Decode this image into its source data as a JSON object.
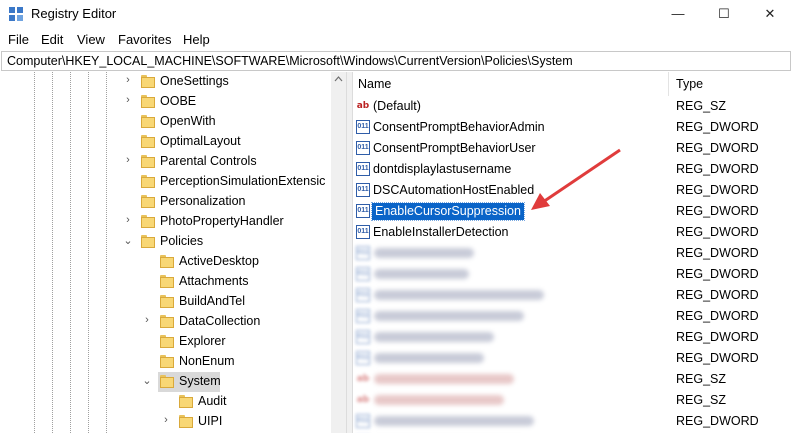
{
  "window": {
    "title": "Registry Editor",
    "controls": {
      "minimize": "—",
      "maximize": "☐",
      "close": "✕"
    }
  },
  "menu": [
    "File",
    "Edit",
    "View",
    "Favorites",
    "Help"
  ],
  "address_path": "Computer\\HKEY_LOCAL_MACHINE\\SOFTWARE\\Microsoft\\Windows\\CurrentVersion\\Policies\\System",
  "tree": [
    {
      "label": "OneSettings",
      "expander": "›"
    },
    {
      "label": "OOBE",
      "expander": "›"
    },
    {
      "label": "OpenWith",
      "expander": ""
    },
    {
      "label": "OptimalLayout",
      "expander": ""
    },
    {
      "label": "Parental Controls",
      "expander": "›"
    },
    {
      "label": "PerceptionSimulationExtensic",
      "expander": ""
    },
    {
      "label": "Personalization",
      "expander": ""
    },
    {
      "label": "PhotoPropertyHandler",
      "expander": "›"
    },
    {
      "label": "Policies",
      "expander": "⌄"
    },
    {
      "label": "ActiveDesktop",
      "expander": ""
    },
    {
      "label": "Attachments",
      "expander": ""
    },
    {
      "label": "BuildAndTel",
      "expander": ""
    },
    {
      "label": "DataCollection",
      "expander": "›"
    },
    {
      "label": "Explorer",
      "expander": ""
    },
    {
      "label": "NonEnum",
      "expander": ""
    },
    {
      "label": "System",
      "expander": "⌄",
      "selected": true
    },
    {
      "label": "Audit",
      "expander": ""
    },
    {
      "label": "UIPI",
      "expander": "›"
    }
  ],
  "list": {
    "columns": {
      "name": "Name",
      "type": "Type"
    },
    "rows": [
      {
        "name": "(Default)",
        "type": "REG_SZ",
        "icon": "string-value-icon"
      },
      {
        "name": "ConsentPromptBehaviorAdmin",
        "type": "REG_DWORD",
        "icon": "dword-value-icon"
      },
      {
        "name": "ConsentPromptBehaviorUser",
        "type": "REG_DWORD",
        "icon": "dword-value-icon"
      },
      {
        "name": "dontdisplaylastusername",
        "type": "REG_DWORD",
        "icon": "dword-value-icon"
      },
      {
        "name": "DSCAutomationHostEnabled",
        "type": "REG_DWORD",
        "icon": "dword-value-icon"
      },
      {
        "name": "EnableCursorSuppression",
        "type": "REG_DWORD",
        "icon": "dword-value-icon",
        "selected": true
      },
      {
        "name": "EnableInstallerDetection",
        "type": "REG_DWORD",
        "icon": "dword-value-icon"
      },
      {
        "name": "",
        "type": "REG_DWORD",
        "icon": "dword-value-icon",
        "blurred": true
      },
      {
        "name": "",
        "type": "REG_DWORD",
        "icon": "dword-value-icon",
        "blurred": true
      },
      {
        "name": "",
        "type": "REG_DWORD",
        "icon": "dword-value-icon",
        "blurred": true
      },
      {
        "name": "",
        "type": "REG_DWORD",
        "icon": "dword-value-icon",
        "blurred": true
      },
      {
        "name": "",
        "type": "REG_DWORD",
        "icon": "dword-value-icon",
        "blurred": true
      },
      {
        "name": "",
        "type": "REG_DWORD",
        "icon": "dword-value-icon",
        "blurred": true
      },
      {
        "name": "",
        "type": "REG_SZ",
        "icon": "string-value-icon",
        "blurred": true
      },
      {
        "name": "",
        "type": "REG_SZ",
        "icon": "string-value-icon",
        "blurred": true
      },
      {
        "name": "",
        "type": "REG_DWORD",
        "icon": "dword-value-icon",
        "blurred": true
      },
      {
        "name": "",
        "type": "REG_DWORD",
        "icon": "dword-value-icon",
        "blurred": true
      }
    ]
  },
  "colors": {
    "selection": "#0a64c8",
    "annotation_arrow": "#e03c3c",
    "folder": "#f8d775"
  }
}
